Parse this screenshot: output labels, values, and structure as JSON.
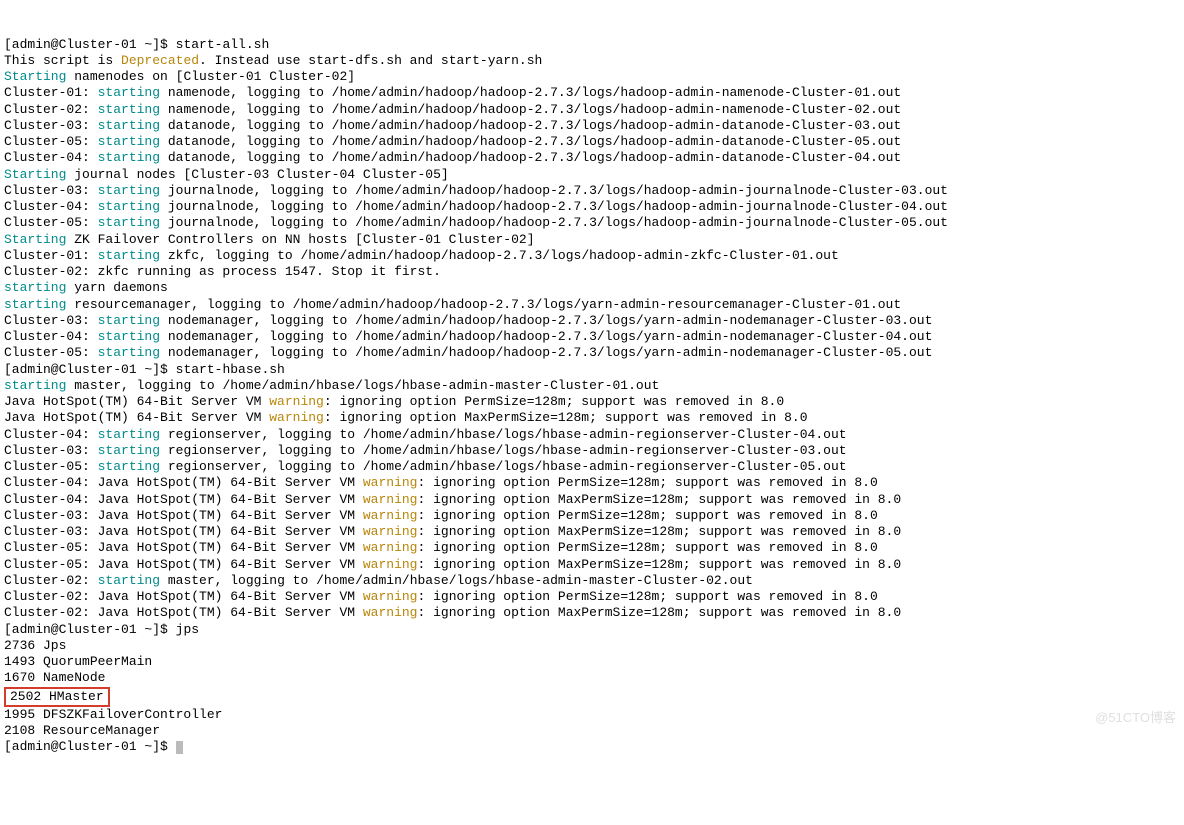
{
  "prompt1": "[admin@Cluster-01 ~]$ ",
  "cmd1": "start-all.sh",
  "l2a": "This script is ",
  "l2b": "Deprecated",
  "l2c": ". Instead use start-dfs.sh and start-yarn.sh",
  "starting": "Starting",
  "starting_lc": "starting",
  "warning": "warning",
  "l3b": " namenodes on [Cluster-01 Cluster-02]",
  "nn": [
    {
      "host": "Cluster-01: ",
      "rest": " namenode, logging to /home/admin/hadoop/hadoop-2.7.3/logs/hadoop-admin-namenode-Cluster-01.out"
    },
    {
      "host": "Cluster-02: ",
      "rest": " namenode, logging to /home/admin/hadoop/hadoop-2.7.3/logs/hadoop-admin-namenode-Cluster-02.out"
    },
    {
      "host": "Cluster-03: ",
      "rest": " datanode, logging to /home/admin/hadoop/hadoop-2.7.3/logs/hadoop-admin-datanode-Cluster-03.out"
    },
    {
      "host": "Cluster-05: ",
      "rest": " datanode, logging to /home/admin/hadoop/hadoop-2.7.3/logs/hadoop-admin-datanode-Cluster-05.out"
    },
    {
      "host": "Cluster-04: ",
      "rest": " datanode, logging to /home/admin/hadoop/hadoop-2.7.3/logs/hadoop-admin-datanode-Cluster-04.out"
    }
  ],
  "l9b": " journal nodes [Cluster-03 Cluster-04 Cluster-05]",
  "jn": [
    {
      "host": "Cluster-03: ",
      "rest": " journalnode, logging to /home/admin/hadoop/hadoop-2.7.3/logs/hadoop-admin-journalnode-Cluster-03.out"
    },
    {
      "host": "Cluster-04: ",
      "rest": " journalnode, logging to /home/admin/hadoop/hadoop-2.7.3/logs/hadoop-admin-journalnode-Cluster-04.out"
    },
    {
      "host": "Cluster-05: ",
      "rest": " journalnode, logging to /home/admin/hadoop/hadoop-2.7.3/logs/hadoop-admin-journalnode-Cluster-05.out"
    }
  ],
  "l13b": " ZK Failover Controllers on NN hosts [Cluster-01 Cluster-02]",
  "zk": [
    {
      "host": "Cluster-01: ",
      "rest": " zkfc, logging to /home/admin/hadoop/hadoop-2.7.3/logs/hadoop-admin-zkfc-Cluster-01.out"
    }
  ],
  "l15": "Cluster-02: zkfc running as process 1547. Stop it first.",
  "l16b": " yarn daemons",
  "yarn": [
    {
      "host": "",
      "rest": " resourcemanager, logging to /home/admin/hadoop/hadoop-2.7.3/logs/yarn-admin-resourcemanager-Cluster-01.out"
    },
    {
      "host": "Cluster-03: ",
      "rest": " nodemanager, logging to /home/admin/hadoop/hadoop-2.7.3/logs/yarn-admin-nodemanager-Cluster-03.out"
    },
    {
      "host": "Cluster-04: ",
      "rest": " nodemanager, logging to /home/admin/hadoop/hadoop-2.7.3/logs/yarn-admin-nodemanager-Cluster-04.out"
    },
    {
      "host": "Cluster-05: ",
      "rest": " nodemanager, logging to /home/admin/hadoop/hadoop-2.7.3/logs/yarn-admin-nodemanager-Cluster-05.out"
    }
  ],
  "cmd2": "start-hbase.sh",
  "l22b": " master, logging to /home/admin/hbase/logs/hbase-admin-master-Cluster-01.out",
  "jvm1a": "Java HotSpot(TM) 64-Bit Server VM ",
  "jvm_perm": ": ignoring option PermSize=128m; support was removed in 8.0",
  "jvm_maxperm": ": ignoring option MaxPermSize=128m; support was removed in 8.0",
  "rs": [
    {
      "host": "Cluster-04: ",
      "rest": " regionserver, logging to /home/admin/hbase/logs/hbase-admin-regionserver-Cluster-04.out"
    },
    {
      "host": "Cluster-03: ",
      "rest": " regionserver, logging to /home/admin/hbase/logs/hbase-admin-regionserver-Cluster-03.out"
    },
    {
      "host": "Cluster-05: ",
      "rest": " regionserver, logging to /home/admin/hbase/logs/hbase-admin-regionserver-Cluster-05.out"
    }
  ],
  "jw": [
    {
      "host": "Cluster-04: ",
      "suf": ": ignoring option PermSize=128m; support was removed in 8.0"
    },
    {
      "host": "Cluster-04: ",
      "suf": ": ignoring option MaxPermSize=128m; support was removed in 8.0"
    },
    {
      "host": "Cluster-03: ",
      "suf": ": ignoring option PermSize=128m; support was removed in 8.0"
    },
    {
      "host": "Cluster-03: ",
      "suf": ": ignoring option MaxPermSize=128m; support was removed in 8.0"
    },
    {
      "host": "Cluster-05: ",
      "suf": ": ignoring option PermSize=128m; support was removed in 8.0"
    },
    {
      "host": "Cluster-05: ",
      "suf": ": ignoring option MaxPermSize=128m; support was removed in 8.0"
    }
  ],
  "c02host": "Cluster-02: ",
  "c02rest": " master, logging to /home/admin/hbase/logs/hbase-admin-master-Cluster-02.out",
  "jw2": [
    {
      "host": "Cluster-02: ",
      "suf": ": ignoring option PermSize=128m; support was removed in 8.0"
    },
    {
      "host": "Cluster-02: ",
      "suf": ": ignoring option MaxPermSize=128m; support was removed in 8.0"
    }
  ],
  "cmd3": "jps",
  "jps": [
    "2736 Jps",
    "1493 QuorumPeerMain",
    "1670 NameNode"
  ],
  "hmaster": "2502 HMaster",
  "jps2": [
    "1995 DFSZKFailoverController",
    "2108 ResourceManager"
  ],
  "watermark": "@51CTO博客"
}
